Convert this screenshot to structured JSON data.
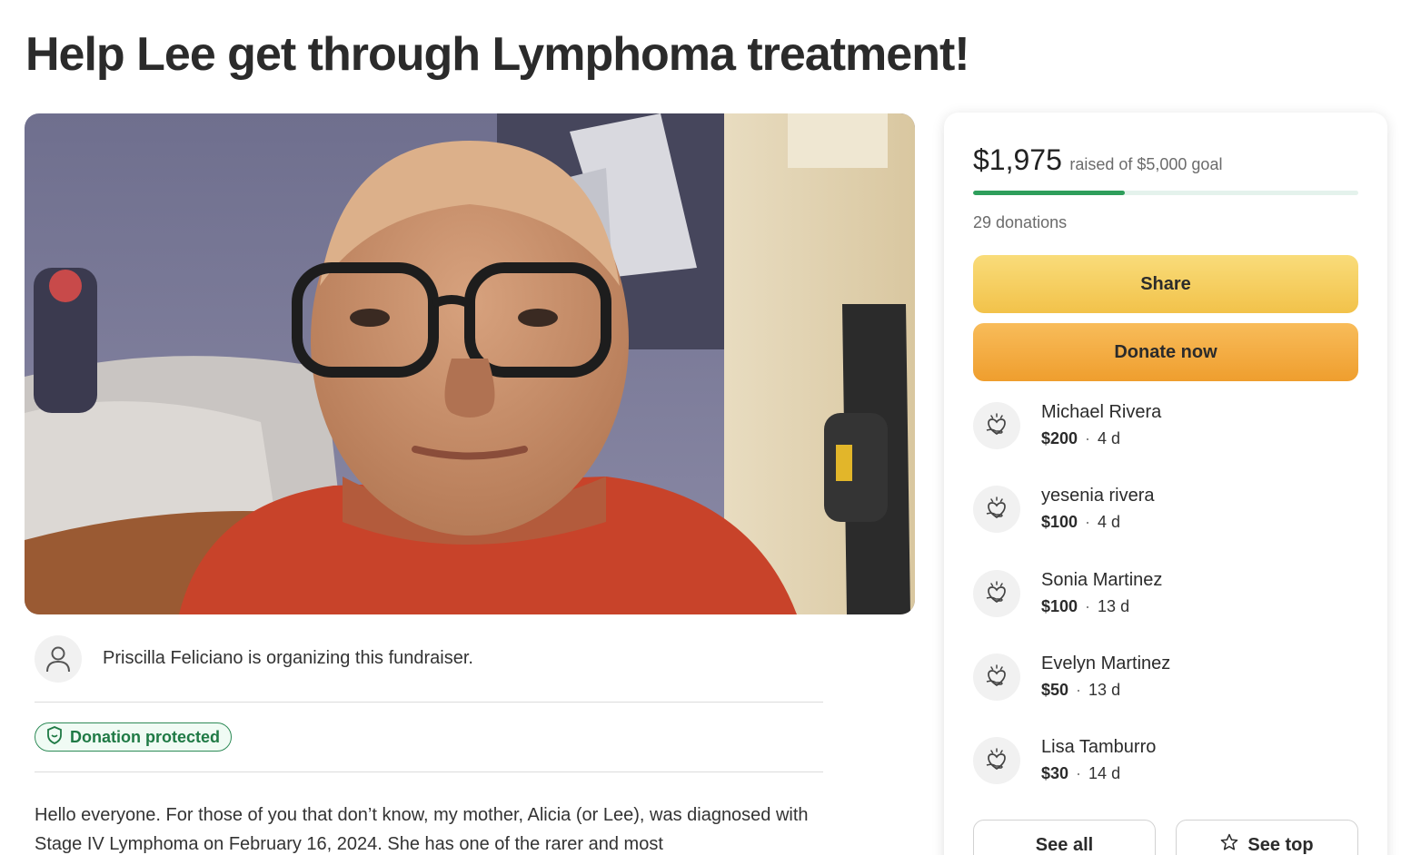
{
  "page": {
    "title": "Help Lee get through Lymphoma treatment!"
  },
  "organizer": {
    "text": "Priscilla Feliciano is organizing this fundraiser."
  },
  "badge": {
    "label": "Donation protected"
  },
  "story": {
    "text": "Hello everyone. For those of you that don’t know, my mother, Alicia (or Lee), was diagnosed with Stage IV Lymphoma on February 16, 2024. She has one of the rarer and most"
  },
  "campaign": {
    "raised": "$1,975",
    "raised_suffix": "raised of $5,000 goal",
    "progress_fraction": 0.395,
    "donations": "29 donations",
    "accent_color": "#2e9e5b"
  },
  "actions": {
    "share_label": "Share",
    "donate_label": "Donate now",
    "see_all_label": "See all",
    "see_top_label": "See top"
  },
  "donors": [
    {
      "name": "Michael Rivera",
      "amount": "$200",
      "ago": "4 d"
    },
    {
      "name": "yesenia rivera",
      "amount": "$100",
      "ago": "4 d"
    },
    {
      "name": "Sonia Martinez",
      "amount": "$100",
      "ago": "13 d"
    },
    {
      "name": "Evelyn Martinez",
      "amount": "$50",
      "ago": "13 d"
    },
    {
      "name": "Lisa Tamburro",
      "amount": "$30",
      "ago": "14 d"
    }
  ],
  "icons": {
    "organizer": "person-icon",
    "badge": "shield-icon",
    "donor": "heart-hand-icon",
    "see_top": "star-icon"
  }
}
